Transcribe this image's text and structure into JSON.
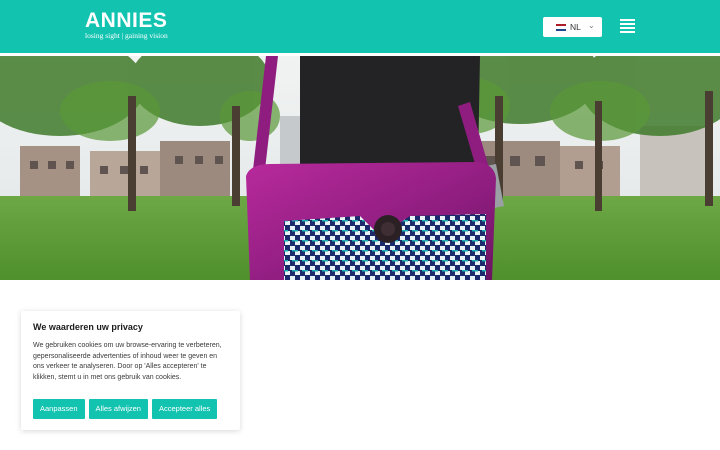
{
  "header": {
    "logo_text": "ANNIES",
    "tagline": "losing sight | gaining vision",
    "language": "NL",
    "language_chevron": "⌄",
    "menu_icon": "hamburger-icon",
    "colors": {
      "brand": "#12c3b0",
      "white": "#ffffff"
    }
  },
  "hero": {
    "icon": "hero-photo",
    "description_icon": "bag-photo"
  },
  "cookie_banner": {
    "title": "We waarderen uw privacy",
    "text": "We gebruiken cookies om uw browse-ervaring te verbeteren, gepersonaliseerde advertenties of inhoud weer te geven en ons verkeer te analyseren. Door op 'Alles accepteren' te klikken, stemt u in met ons gebruik van cookies.",
    "buttons": {
      "customize": "Aanpassen",
      "reject_all": "Alles afwijzen",
      "accept_all": "Accepteer alles"
    }
  }
}
